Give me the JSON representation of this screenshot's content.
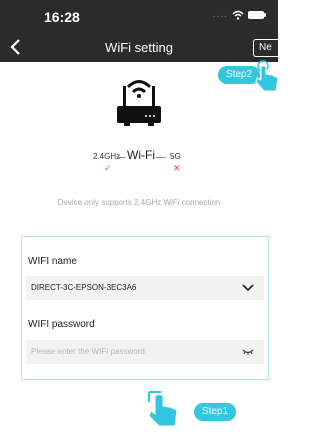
{
  "status_bar": {
    "time": "16:28",
    "signal_dots": "....",
    "wifi_icon": "wifi-icon",
    "battery_icon": "battery-icon"
  },
  "nav": {
    "title": "WiFi setting",
    "next_label": "Ne",
    "back_icon": "chevron-left-icon"
  },
  "guides": {
    "step1": "Step1",
    "step2": "Step2"
  },
  "band_info": {
    "freq_24": "2.4GHz",
    "wifi_label": "Wi-Fi",
    "freq_5": "5G",
    "supported_mark": "✓",
    "unsupported_mark": "✕",
    "note": "Device only supports 2.4GHz WiFi connection"
  },
  "form": {
    "name_label": "WIFI name",
    "name_value": "DIRECT-3C-EPSON-3EC3A6",
    "password_label": "WIFI password",
    "password_placeholder": "Please enter the WIFI password"
  },
  "colors": {
    "accent": "#31c7e1",
    "header": "#2b2b2b",
    "ok": "#2ec46d",
    "error": "#e0463c"
  }
}
